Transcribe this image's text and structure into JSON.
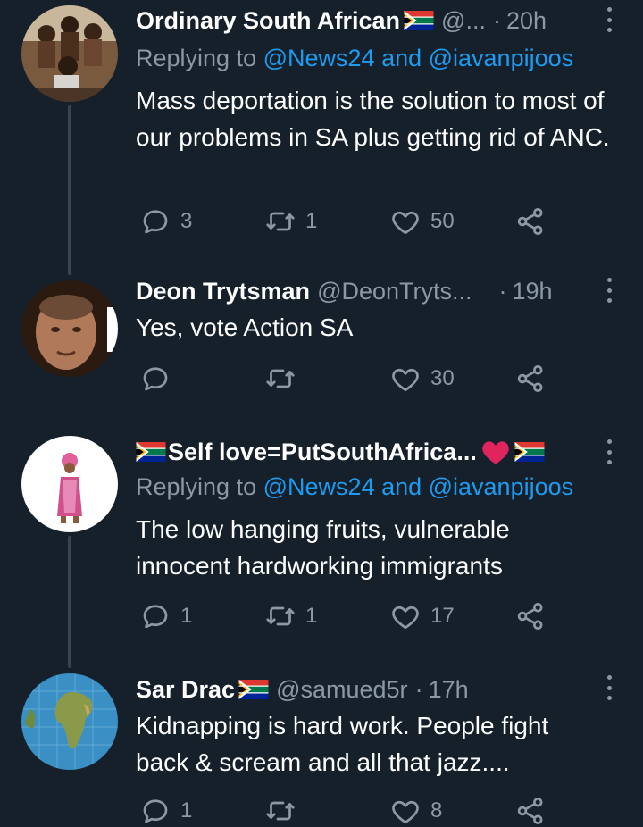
{
  "tweets": [
    {
      "name": "Ordinary South African",
      "handle": "@...",
      "dot": "·",
      "time": "20h",
      "reply_prefix": "Replying to",
      "reply_targets": "@News24 and @iavanpijoos",
      "text": "Mass deportation is the solution to most of our problems in SA plus getting rid of ANC.",
      "replies": "3",
      "retweets": "1",
      "likes": "50"
    },
    {
      "name": "Deon Trytsman",
      "handle": "@DeonTryts...",
      "dot": "·",
      "time": "19h",
      "text": "Yes, vote Action SA",
      "replies": "",
      "retweets": "",
      "likes": "30"
    },
    {
      "name": "Self love=PutSouthAfrica...",
      "handle": "",
      "dot": "",
      "time": "",
      "reply_prefix": "Replying to",
      "reply_targets": "@News24 and @iavanpijoos",
      "text": "The low hanging fruits, vulnerable innocent hardworking immigrants",
      "replies": "1",
      "retweets": "1",
      "likes": "17"
    },
    {
      "name": "Sar Drac",
      "handle": "@samued5r",
      "dot": "·",
      "time": "17h",
      "text": "Kidnapping is hard work. People fight back & scream and all that jazz....",
      "replies": "1",
      "retweets": "",
      "likes": "8"
    }
  ],
  "icons": {
    "reply": "reply-icon",
    "retweet": "retweet-icon",
    "like": "heart-icon",
    "share": "share-icon",
    "more": "more-options-icon"
  },
  "colors": {
    "background": "#15202b",
    "link": "#1d9bf0",
    "muted": "#8b98a5",
    "divider": "#38444d"
  }
}
